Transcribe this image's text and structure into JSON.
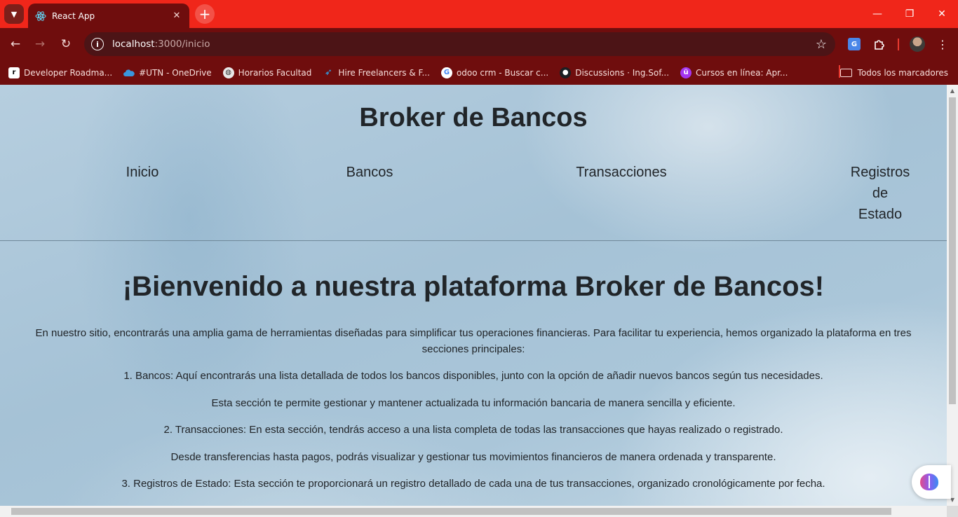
{
  "browser": {
    "tab": {
      "title": "React App"
    },
    "url": {
      "host": "localhost",
      "path": ":3000/inicio"
    },
    "bookmarks": [
      {
        "label": "Developer Roadma...",
        "icon": "roadmap-icon"
      },
      {
        "label": "#UTN - OneDrive",
        "icon": "onedrive-icon"
      },
      {
        "label": "Horarios Facultad",
        "icon": "globe-icon"
      },
      {
        "label": "Hire Freelancers & F...",
        "icon": "freelancer-icon"
      },
      {
        "label": "odoo crm - Buscar c...",
        "icon": "google-icon"
      },
      {
        "label": "Discussions · Ing.Sof...",
        "icon": "github-icon"
      },
      {
        "label": "Cursos en línea: Apr...",
        "icon": "udemy-icon"
      }
    ],
    "all_bookmarks_label": "Todos los marcadores",
    "colors": {
      "tab_strip": "#f0261a",
      "toolbar": "#6f0d0d",
      "omnibox": "#4c1416"
    }
  },
  "page": {
    "site_title": "Broker de Bancos",
    "nav": {
      "inicio": "Inicio",
      "bancos": "Bancos",
      "transacciones": "Transacciones",
      "registros_line1": "Registros",
      "registros_line2": "de",
      "registros_line3": "Estado"
    },
    "welcome_heading": "¡Bienvenido a nuestra plataforma Broker de Bancos!",
    "paragraphs": [
      "En nuestro sitio, encontrarás una amplia gama de herramientas diseñadas para simplificar tus operaciones financieras. Para facilitar tu experiencia, hemos organizado la plataforma en tres secciones principales:",
      "1. Bancos: Aquí encontrarás una lista detallada de todos los bancos disponibles, junto con la opción de añadir nuevos bancos según tus necesidades.",
      "Esta sección te permite gestionar y mantener actualizada tu información bancaria de manera sencilla y eficiente.",
      "2. Transacciones: En esta sección, tendrás acceso a una lista completa de todas las transacciones que hayas realizado o registrado.",
      "Desde transferencias hasta pagos, podrás visualizar y gestionar tus movimientos financieros de manera ordenada y transparente.",
      "3. Registros de Estado: Esta sección te proporcionará un registro detallado de cada una de tus transacciones, organizado cronológicamente por fecha."
    ]
  }
}
